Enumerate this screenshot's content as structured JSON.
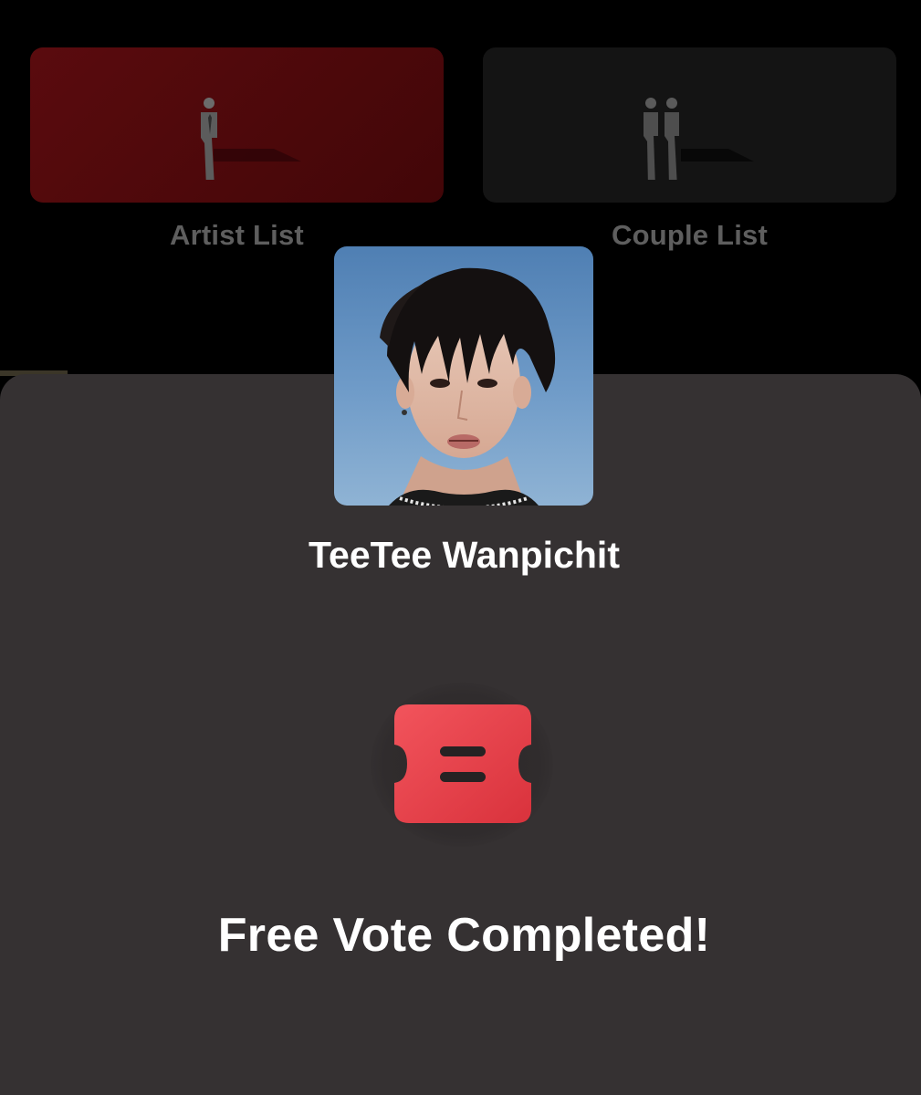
{
  "tabs": [
    {
      "label": "Artist List",
      "icon": "single-person-icon",
      "active": true
    },
    {
      "label": "Couple List",
      "icon": "two-people-icon",
      "active": false
    }
  ],
  "popup": {
    "artist_name": "TeeTee Wanpichit",
    "ticket_icon": "vote-ticket-icon",
    "message": "Free Vote Completed!"
  },
  "colors": {
    "accent": "#e8434c",
    "sheet_background": "#353132",
    "active_tab": "#4a0709"
  }
}
